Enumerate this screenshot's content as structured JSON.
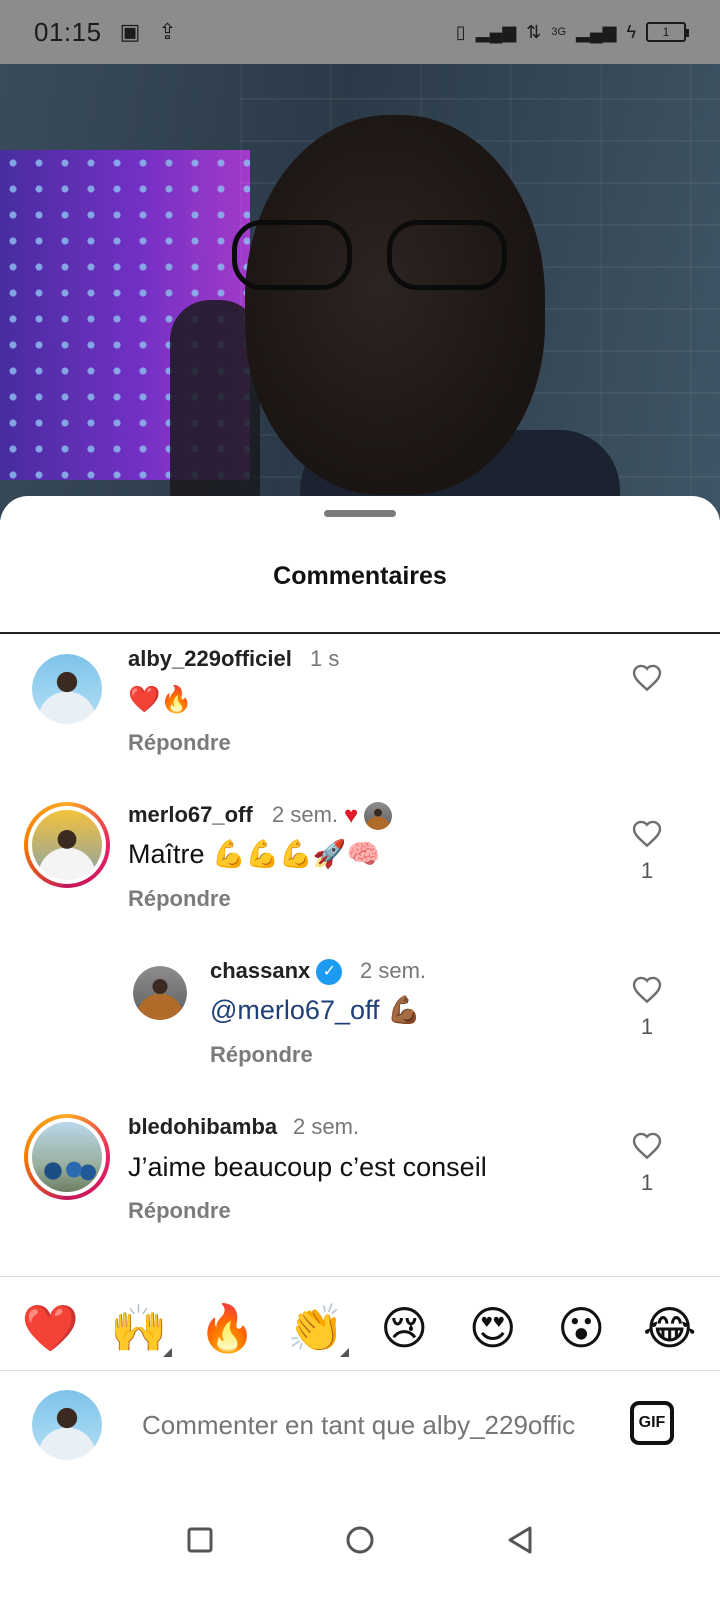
{
  "status_bar": {
    "time": "01:15",
    "network": "3G",
    "battery": "1"
  },
  "sheet": {
    "title": "Commentaires"
  },
  "comments": [
    {
      "username": "alby_229officiel",
      "time": "1 s",
      "text": "❤️🔥",
      "reply_label": "Répondre",
      "likes": ""
    },
    {
      "username": "merlo67_off",
      "time": "2 sem.",
      "text": "Maître 💪💪💪🚀🧠",
      "reply_label": "Répondre",
      "likes": "1"
    },
    {
      "username": "chassanx",
      "time": "2 sem.",
      "mention": "@merlo67_off",
      "text": "💪🏾",
      "reply_label": "Répondre",
      "likes": "1"
    },
    {
      "username": "bledohibamba",
      "time": "2 sem.",
      "text": "J’aime beaucoup c’est conseil",
      "reply_label": "Répondre",
      "likes": "1"
    }
  ],
  "reactions": [
    "❤️",
    "🙌",
    "🔥",
    "👏",
    "😢",
    "😍",
    "😮",
    "😂"
  ],
  "composer": {
    "placeholder": "Commenter en tant que alby_229offic",
    "gif_label": "GIF"
  },
  "colors": {
    "like_heart": "#e3192b",
    "verified": "#1d9bf0",
    "mention": "#1f3f78"
  }
}
